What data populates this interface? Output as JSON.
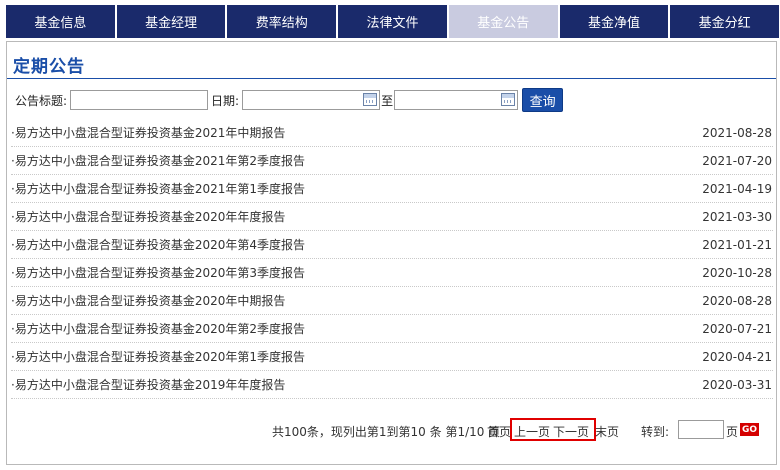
{
  "tabs": [
    {
      "label": "基金信息",
      "active": false
    },
    {
      "label": "基金经理",
      "active": false
    },
    {
      "label": "费率结构",
      "active": false
    },
    {
      "label": "法律文件",
      "active": false
    },
    {
      "label": "基金公告",
      "active": true
    },
    {
      "label": "基金净值",
      "active": false
    },
    {
      "label": "基金分红",
      "active": false
    }
  ],
  "section_title": "定期公告",
  "search": {
    "title_label": "公告标题:",
    "title_value": "",
    "date_label": "日期:",
    "date_from_value": "",
    "date_to_label": "至",
    "date_to_value": "",
    "query_button": "查询"
  },
  "announcements": [
    {
      "title": "·易方达中小盘混合型证券投资基金2021年中期报告",
      "date": "2021-08-28"
    },
    {
      "title": "·易方达中小盘混合型证券投资基金2021年第2季度报告",
      "date": "2021-07-20"
    },
    {
      "title": "·易方达中小盘混合型证券投资基金2021年第1季度报告",
      "date": "2021-04-19"
    },
    {
      "title": "·易方达中小盘混合型证券投资基金2020年年度报告",
      "date": "2021-03-30"
    },
    {
      "title": "·易方达中小盘混合型证券投资基金2020年第4季度报告",
      "date": "2021-01-21"
    },
    {
      "title": "·易方达中小盘混合型证券投资基金2020年第3季度报告",
      "date": "2020-10-28"
    },
    {
      "title": "·易方达中小盘混合型证券投资基金2020年中期报告",
      "date": "2020-08-28"
    },
    {
      "title": "·易方达中小盘混合型证券投资基金2020年第2季度报告",
      "date": "2020-07-21"
    },
    {
      "title": "·易方达中小盘混合型证券投资基金2020年第1季度报告",
      "date": "2020-04-21"
    },
    {
      "title": "·易方达中小盘混合型证券投资基金2019年年度报告",
      "date": "2020-03-31"
    }
  ],
  "pager": {
    "summary": "共100条，现列出第1到第10 条 第1/10 页",
    "first": "首页",
    "prev": "上一页",
    "next": "下一页",
    "last": "末页",
    "goto_label": "转到:",
    "goto_value": "",
    "page_unit": "页",
    "go_button": "GO"
  },
  "colors": {
    "tab_bg": "#1a2a6b",
    "tab_active_bg": "#c9cbe0",
    "accent": "#1a4ea8",
    "highlight_box": "#e00000"
  },
  "icons": {
    "calendar": "calendar-icon"
  }
}
